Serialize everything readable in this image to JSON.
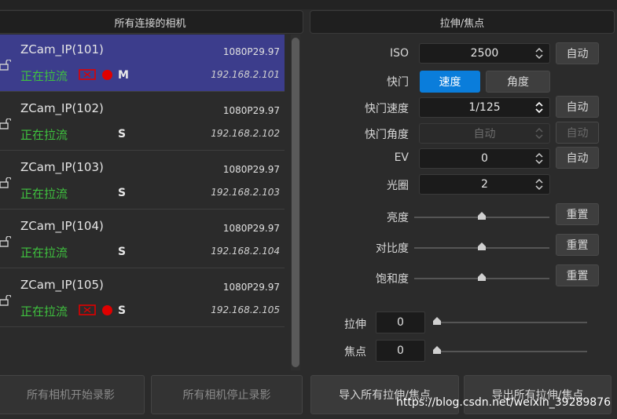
{
  "left_panel": {
    "title": "所有连接的相机",
    "cameras": [
      {
        "name": "ZCam_IP(101)",
        "resolution": "1080P29.97",
        "status": "正在拉流",
        "ip": "192.168.2.101",
        "role": "M",
        "recording": true,
        "selected": true
      },
      {
        "name": "ZCam_IP(102)",
        "resolution": "1080P29.97",
        "status": "正在拉流",
        "ip": "192.168.2.102",
        "role": "S",
        "recording": false,
        "selected": false
      },
      {
        "name": "ZCam_IP(103)",
        "resolution": "1080P29.97",
        "status": "正在拉流",
        "ip": "192.168.2.103",
        "role": "S",
        "recording": false,
        "selected": false
      },
      {
        "name": "ZCam_IP(104)",
        "resolution": "1080P29.97",
        "status": "正在拉流",
        "ip": "192.168.2.104",
        "role": "S",
        "recording": false,
        "selected": false
      },
      {
        "name": "ZCam_IP(105)",
        "resolution": "1080P29.97",
        "status": "正在拉流",
        "ip": "192.168.2.105",
        "role": "S",
        "recording": true,
        "selected": false
      }
    ],
    "start_all_label": "所有相机开始录影",
    "stop_all_label": "所有相机停止录影"
  },
  "right_panel": {
    "title": "拉伸/焦点",
    "iso": {
      "label": "ISO",
      "value": "2500",
      "auto_label": "自动"
    },
    "shutter": {
      "label": "快门",
      "speed_label": "速度",
      "angle_label": "角度"
    },
    "shutter_speed": {
      "label": "快门速度",
      "value": "1/125",
      "auto_label": "自动"
    },
    "shutter_angle": {
      "label": "快门角度",
      "value": "自动",
      "auto_label": "自动"
    },
    "ev": {
      "label": "EV",
      "value": "0",
      "auto_label": "自动"
    },
    "iris": {
      "label": "光圈",
      "value": "2"
    },
    "brightness": {
      "label": "亮度",
      "reset_label": "重置",
      "level": 0.5
    },
    "contrast": {
      "label": "对比度",
      "reset_label": "重置",
      "level": 0.5
    },
    "saturation": {
      "label": "饱和度",
      "reset_label": "重置",
      "level": 0.5
    },
    "zoom": {
      "label": "拉伸",
      "value": "0",
      "level": 0
    },
    "focus": {
      "label": "焦点",
      "value": "0",
      "level": 0
    },
    "import_label": "导入所有拉伸/焦点",
    "export_label": "导出所有拉伸/焦点"
  },
  "watermark": "https://blog.csdn.net/weixin_39289876",
  "colors": {
    "selected_row": "#3c3d8c",
    "status_green": "#3fc23f",
    "accent_blue": "#0a7ddb",
    "record_red": "#e00000"
  }
}
